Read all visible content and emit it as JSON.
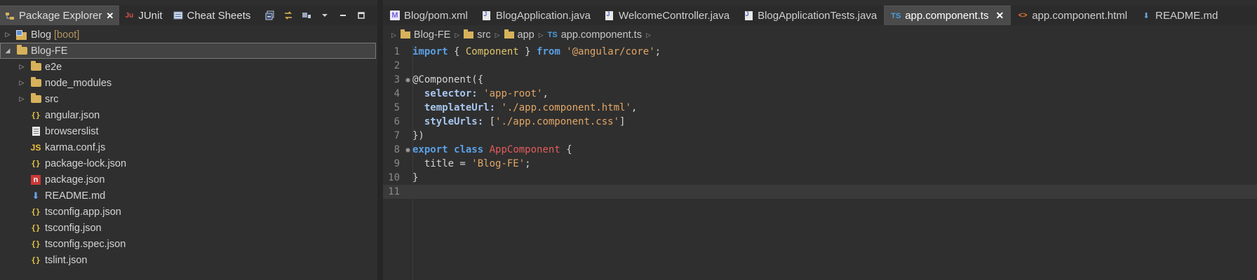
{
  "left_panel": {
    "tabs": [
      {
        "label": "Package Explorer",
        "icon": "package-explorer-icon",
        "active": true,
        "closable": true
      },
      {
        "label": "JUnit",
        "icon": "junit-icon",
        "active": false
      },
      {
        "label": "Cheat Sheets",
        "icon": "cheat-sheets-icon",
        "active": false
      }
    ],
    "toolbar_icons": [
      "collapse-all-icon",
      "link-with-editor-icon",
      "view-menu-icon",
      "chevron-down-icon",
      "minimize-icon",
      "maximize-icon"
    ],
    "tree": [
      {
        "label": "Blog",
        "suffix": "[boot]",
        "icon": "project-icon",
        "expanded": false,
        "level": 0
      },
      {
        "label": "Blog-FE",
        "icon": "folder-open-icon",
        "expanded": true,
        "level": 0,
        "selected": true
      },
      {
        "label": "e2e",
        "icon": "folder-icon",
        "expanded": false,
        "level": 1
      },
      {
        "label": "node_modules",
        "icon": "folder-icon",
        "expanded": false,
        "level": 1
      },
      {
        "label": "src",
        "icon": "folder-icon",
        "expanded": false,
        "level": 1
      },
      {
        "label": "angular.json",
        "icon": "json-icon",
        "level": 1
      },
      {
        "label": "browserslist",
        "icon": "text-file-icon",
        "level": 1
      },
      {
        "label": "karma.conf.js",
        "icon": "js-icon",
        "level": 1
      },
      {
        "label": "package-lock.json",
        "icon": "json-icon",
        "level": 1
      },
      {
        "label": "package.json",
        "icon": "npm-icon",
        "level": 1
      },
      {
        "label": "README.md",
        "icon": "markdown-icon",
        "level": 1
      },
      {
        "label": "tsconfig.app.json",
        "icon": "json-icon",
        "level": 1
      },
      {
        "label": "tsconfig.json",
        "icon": "json-icon",
        "level": 1
      },
      {
        "label": "tsconfig.spec.json",
        "icon": "json-icon",
        "level": 1
      },
      {
        "label": "tslint.json",
        "icon": "json-icon",
        "level": 1
      }
    ]
  },
  "editor": {
    "tabs": [
      {
        "label": "Blog/pom.xml",
        "icon": "maven-icon",
        "active": false
      },
      {
        "label": "BlogApplication.java",
        "icon": "java-file-icon",
        "active": false
      },
      {
        "label": "WelcomeController.java",
        "icon": "java-file-icon",
        "active": false
      },
      {
        "label": "BlogApplicationTests.java",
        "icon": "java-file-icon",
        "active": false
      },
      {
        "label": "app.component.ts",
        "icon": "typescript-icon",
        "active": true
      },
      {
        "label": "app.component.html",
        "icon": "html-icon",
        "active": false
      },
      {
        "label": "README.md",
        "icon": "markdown-icon",
        "active": false
      }
    ],
    "breadcrumb": [
      {
        "label": "Blog-FE",
        "icon": "folder-icon"
      },
      {
        "label": "src",
        "icon": "folder-icon"
      },
      {
        "label": "app",
        "icon": "folder-icon"
      },
      {
        "label": "app.component.ts",
        "icon": "typescript-icon"
      }
    ],
    "ts_badge": "TS",
    "lines": [
      {
        "n": "1",
        "fold": false,
        "tokens": [
          [
            "kw",
            "import"
          ],
          [
            "p",
            " { "
          ],
          [
            "ty",
            "Component"
          ],
          [
            "p",
            " } "
          ],
          [
            "kw",
            "from"
          ],
          [
            "p",
            " "
          ],
          [
            "st",
            "'@angular/core'"
          ],
          [
            "p",
            ";"
          ]
        ]
      },
      {
        "n": "2",
        "fold": false,
        "tokens": []
      },
      {
        "n": "3",
        "fold": true,
        "tokens": [
          [
            "dec",
            "@Component({"
          ]
        ]
      },
      {
        "n": "4",
        "fold": false,
        "tokens": [
          [
            "p",
            "  "
          ],
          [
            "prop",
            "selector:"
          ],
          [
            "p",
            " "
          ],
          [
            "st",
            "'app-root'"
          ],
          [
            "p",
            ","
          ]
        ]
      },
      {
        "n": "5",
        "fold": false,
        "tokens": [
          [
            "p",
            "  "
          ],
          [
            "prop",
            "templateUrl:"
          ],
          [
            "p",
            " "
          ],
          [
            "st",
            "'./app.component.html'"
          ],
          [
            "p",
            ","
          ]
        ]
      },
      {
        "n": "6",
        "fold": false,
        "tokens": [
          [
            "p",
            "  "
          ],
          [
            "prop",
            "styleUrls:"
          ],
          [
            "p",
            " ["
          ],
          [
            "st",
            "'./app.component.css'"
          ],
          [
            "p",
            "]"
          ]
        ]
      },
      {
        "n": "7",
        "fold": false,
        "tokens": [
          [
            "p",
            "})"
          ]
        ]
      },
      {
        "n": "8",
        "fold": true,
        "tokens": [
          [
            "kw",
            "export"
          ],
          [
            "p",
            " "
          ],
          [
            "kw",
            "class"
          ],
          [
            "p",
            " "
          ],
          [
            "cls",
            "AppComponent"
          ],
          [
            "p",
            " {"
          ]
        ]
      },
      {
        "n": "9",
        "fold": false,
        "tokens": [
          [
            "p",
            "  title = "
          ],
          [
            "st",
            "'Blog-FE'"
          ],
          [
            "p",
            ";"
          ]
        ]
      },
      {
        "n": "10",
        "fold": false,
        "tokens": [
          [
            "p",
            "}"
          ]
        ]
      },
      {
        "n": "11",
        "fold": false,
        "tokens": [],
        "current": true
      }
    ]
  },
  "colors": {
    "background": "#2f2f2f",
    "tab_active": "#4b4b4b",
    "keyword": "#5aa0e6",
    "string": "#e2a766",
    "type": "#e0c46c",
    "class_name": "#e35b5b",
    "folder": "#d7b25b"
  }
}
